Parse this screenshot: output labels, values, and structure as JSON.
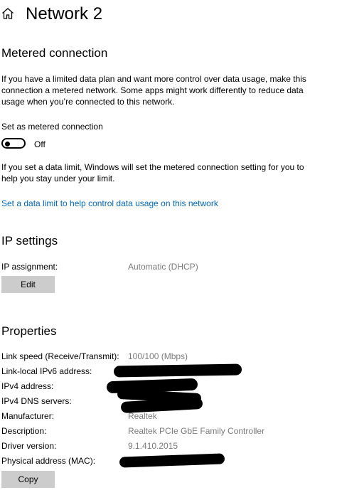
{
  "header": {
    "title": "Network 2",
    "home_icon": "home-icon"
  },
  "metered": {
    "heading": "Metered connection",
    "description": "If you have a limited data plan and want more control over data usage, make this connection a metered network. Some apps might work differently to reduce data usage when you’re connected to this network.",
    "toggle_label": "Set as metered connection",
    "toggle_state": "Off",
    "toggle_on": false,
    "limit_note": "If you set a data limit, Windows will set the metered connection setting for you to help you stay under your limit.",
    "data_limit_link": "Set a data limit to help control data usage on this network"
  },
  "ip_settings": {
    "heading": "IP settings",
    "assignment_label": "IP assignment:",
    "assignment_value": "Automatic (DHCP)",
    "edit_button": "Edit"
  },
  "properties": {
    "heading": "Properties",
    "rows": [
      {
        "label": "Link speed (Receive/Transmit):",
        "value": "100/100 (Mbps)"
      },
      {
        "label": "Link-local IPv6 address:",
        "value": ""
      },
      {
        "label": "IPv4 address:",
        "value": ""
      },
      {
        "label": "IPv4 DNS servers:",
        "value": ""
      },
      {
        "label": "Manufacturer:",
        "value": "Realtek"
      },
      {
        "label": "Description:",
        "value": "Realtek PCIe GbE Family Controller"
      },
      {
        "label": "Driver version:",
        "value": "9.1.410.2015"
      },
      {
        "label": "Physical address (MAC):",
        "value": ""
      }
    ],
    "copy_button": "Copy"
  },
  "colors": {
    "link": "#0067c0",
    "button_bg": "#cccccc",
    "value_text": "#7a7a7a"
  }
}
